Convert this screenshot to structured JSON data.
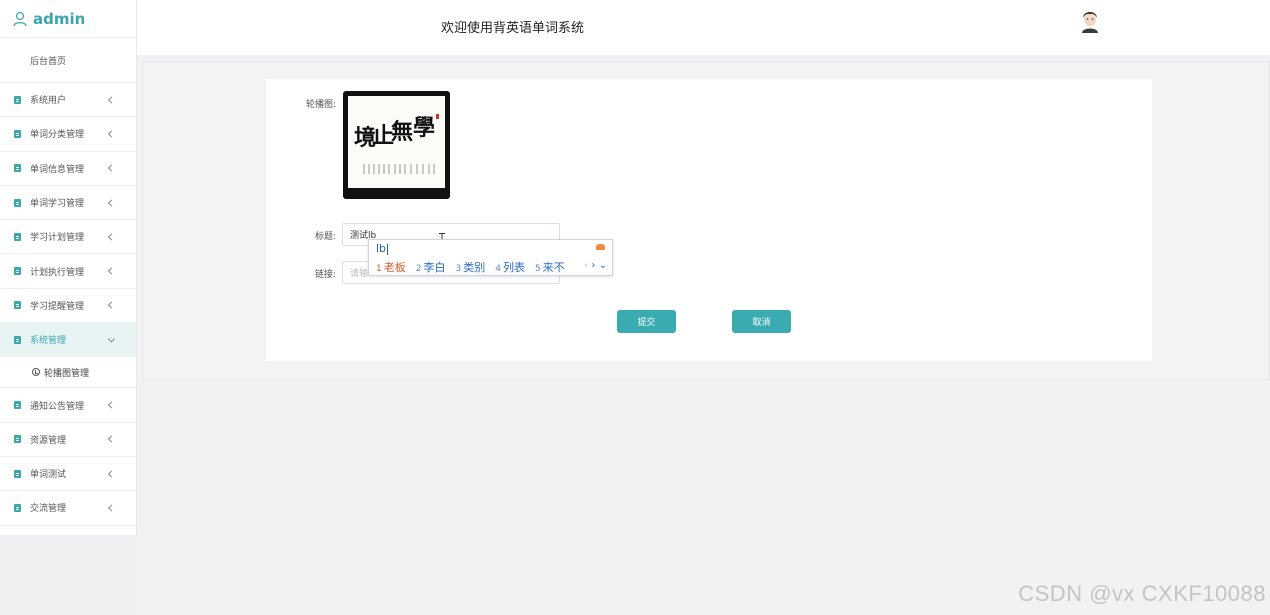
{
  "sidebar": {
    "brand": "admin",
    "home": "后台首页",
    "items": [
      {
        "label": "系统用户"
      },
      {
        "label": "单词分类管理"
      },
      {
        "label": "单词信息管理"
      },
      {
        "label": "单词学习管理"
      },
      {
        "label": "学习计划管理"
      },
      {
        "label": "计划执行管理"
      },
      {
        "label": "学习提醒管理"
      },
      {
        "label": "系统管理",
        "active": true
      },
      {
        "label": "通知公告管理"
      },
      {
        "label": "资源管理"
      },
      {
        "label": "单词测试"
      },
      {
        "label": "交流管理"
      }
    ],
    "sub_item": "轮播图管理"
  },
  "header": {
    "title": "欢迎使用背英语单词系统"
  },
  "form": {
    "carousel_label": "轮播图:",
    "carousel_image": {
      "main_chars": [
        "學",
        "無",
        "止",
        "境"
      ]
    },
    "title_label": "标题:",
    "title_value": "测试lb",
    "link_label": "链接:",
    "link_placeholder": "请输",
    "submit": "提交",
    "cancel": "取消"
  },
  "ime": {
    "composition": "lb",
    "candidates": [
      {
        "num": "1",
        "text": "老板"
      },
      {
        "num": "2",
        "text": "李白"
      },
      {
        "num": "3",
        "text": "类别"
      },
      {
        "num": "4",
        "text": "列表"
      },
      {
        "num": "5",
        "text": "来不"
      }
    ],
    "prev": "‹",
    "next": "›",
    "expand": "⌄"
  },
  "watermark": "CSDN @vx  CXKF10088",
  "colors": {
    "accent": "#3aabb1",
    "ime_selected": "#e2572b",
    "ime_candidate": "#2a6bc8"
  }
}
